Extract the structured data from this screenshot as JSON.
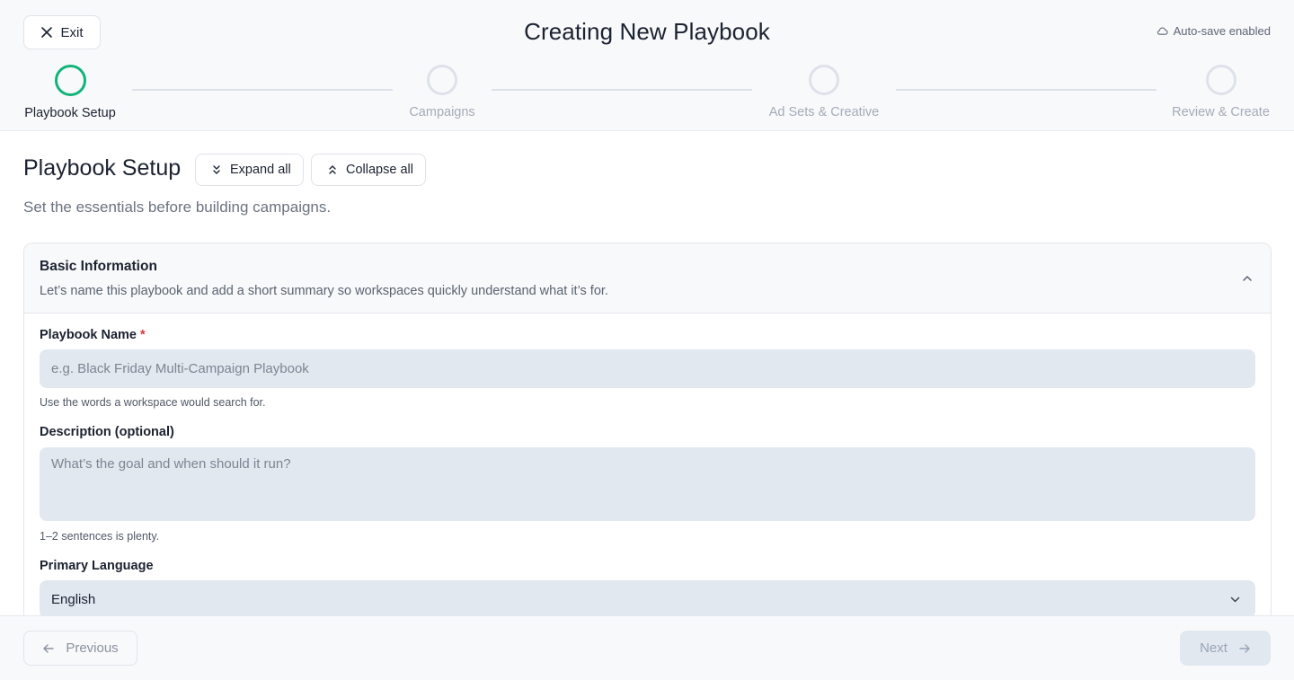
{
  "header": {
    "exit_label": "Exit",
    "title": "Creating New Playbook",
    "autosave_label": "Auto-save enabled"
  },
  "stepper": {
    "steps": [
      {
        "label": "Playbook Setup",
        "state": "active"
      },
      {
        "label": "Campaigns",
        "state": "pending"
      },
      {
        "label": "Ad Sets & Creative",
        "state": "pending"
      },
      {
        "label": "Review & Create",
        "state": "pending"
      }
    ]
  },
  "section": {
    "title": "Playbook Setup",
    "expand_all_label": "Expand all",
    "collapse_all_label": "Collapse all",
    "subtitle": "Set the essentials before building campaigns."
  },
  "card": {
    "title": "Basic Information",
    "description": "Let’s name this playbook and add a short summary so workspaces quickly understand what it’s for.",
    "fields": {
      "name": {
        "label": "Playbook Name",
        "required_mark": "*",
        "value": "",
        "placeholder": "e.g. Black Friday Multi-Campaign Playbook",
        "help": "Use the words a workspace would search for."
      },
      "description": {
        "label": "Description (optional)",
        "value": "",
        "placeholder": "What’s the goal and when should it run?",
        "help": "1–2 sentences is plenty."
      },
      "language": {
        "label": "Primary Language",
        "value": "English"
      }
    }
  },
  "footer": {
    "previous_label": "Previous",
    "next_label": "Next"
  },
  "colors": {
    "accent_green": "#12b47a",
    "required_red": "#d43a3a",
    "input_bg": "#e2e8f0"
  },
  "icons": {
    "exit": "close-icon",
    "autosave": "cloud-icon",
    "expand": "chevrons-down-icon",
    "collapse": "chevrons-up-icon",
    "card_toggle": "chevron-up-icon",
    "select": "chevron-down-icon",
    "previous": "arrow-left-icon",
    "next": "arrow-right-icon"
  }
}
